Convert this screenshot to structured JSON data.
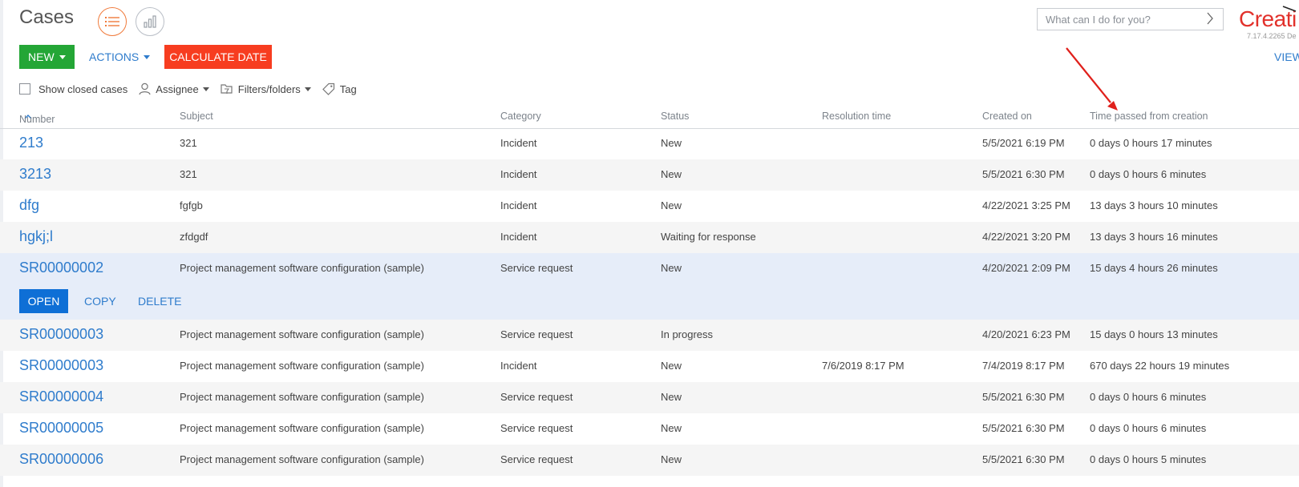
{
  "page": {
    "title": "Cases",
    "search_placeholder": "What can I do for you?",
    "logo_text": "Creati",
    "version": "7.17.4.2265 De",
    "view_link": "VIEW"
  },
  "toolbar": {
    "new_label": "NEW",
    "actions_label": "ACTIONS",
    "calculate_label": "CALCULATE DATE"
  },
  "filters": {
    "show_closed": "Show closed cases",
    "assignee": "Assignee",
    "filters_folders": "Filters/folders",
    "tag": "Tag"
  },
  "columns": {
    "number": "Number",
    "subject": "Subject",
    "category": "Category",
    "status": "Status",
    "resolution": "Resolution time",
    "created": "Created on",
    "time_passed": "Time passed from creation"
  },
  "row_actions": {
    "open": "OPEN",
    "copy": "COPY",
    "delete": "DELETE"
  },
  "rows": [
    {
      "number": "213",
      "subject": "321",
      "category": "Incident",
      "status": "New",
      "resolution": "",
      "created": "5/5/2021 6:19 PM",
      "time_passed": "0 days 0 hours 17 minutes"
    },
    {
      "number": "3213",
      "subject": "321",
      "category": "Incident",
      "status": "New",
      "resolution": "",
      "created": "5/5/2021 6:30 PM",
      "time_passed": "0 days 0 hours 6 minutes"
    },
    {
      "number": "dfg",
      "subject": "fgfgb",
      "category": "Incident",
      "status": "New",
      "resolution": "",
      "created": "4/22/2021 3:25 PM",
      "time_passed": "13 days 3 hours 10 minutes"
    },
    {
      "number": "hgkj;l",
      "subject": "zfdgdf",
      "category": "Incident",
      "status": "Waiting for response",
      "resolution": "",
      "created": "4/22/2021 3:20 PM",
      "time_passed": "13 days 3 hours 16 minutes"
    },
    {
      "number": "SR00000002",
      "subject": "Project management software configuration (sample)",
      "category": "Service request",
      "status": "New",
      "resolution": "",
      "created": "4/20/2021 2:09 PM",
      "time_passed": "15 days 4 hours 26 minutes"
    },
    {
      "number": "SR00000003",
      "subject": "Project management software configuration (sample)",
      "category": "Service request",
      "status": "In progress",
      "resolution": "",
      "created": "4/20/2021 6:23 PM",
      "time_passed": "15 days 0 hours 13 minutes"
    },
    {
      "number": "SR00000003",
      "subject": "Project management software configuration (sample)",
      "category": "Incident",
      "status": "New",
      "resolution": "7/6/2019 8:17 PM",
      "created": "7/4/2019 8:17 PM",
      "time_passed": "670 days 22 hours 19 minutes"
    },
    {
      "number": "SR00000004",
      "subject": "Project management software configuration (sample)",
      "category": "Service request",
      "status": "New",
      "resolution": "",
      "created": "5/5/2021 6:30 PM",
      "time_passed": "0 days 0 hours 6 minutes"
    },
    {
      "number": "SR00000005",
      "subject": "Project management software configuration (sample)",
      "category": "Service request",
      "status": "New",
      "resolution": "",
      "created": "5/5/2021 6:30 PM",
      "time_passed": "0 days 0 hours 6 minutes"
    },
    {
      "number": "SR00000006",
      "subject": "Project management software configuration (sample)",
      "category": "Service request",
      "status": "New",
      "resolution": "",
      "created": "5/5/2021 6:30 PM",
      "time_passed": "0 days 0 hours 5 minutes"
    }
  ],
  "colors": {
    "accent_blue": "#2f7ccc",
    "new_green": "#24a636",
    "calc_red": "#f73d20",
    "open_blue": "#0e6fd6",
    "selected_row": "#e6edf9",
    "annotation_red": "#e0201b"
  },
  "icons": [
    "list-view-icon",
    "analytics-view-icon",
    "chevron-right-icon",
    "user-icon",
    "folder-filter-icon",
    "tag-icon",
    "sort-ascending-icon"
  ]
}
